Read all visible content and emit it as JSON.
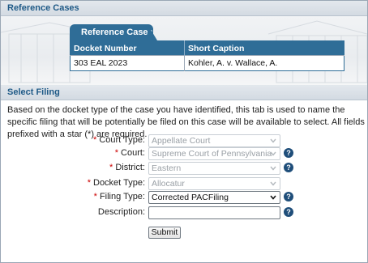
{
  "sections": {
    "reference_cases_title": "Reference Cases",
    "select_filing_title": "Select Filing"
  },
  "reference_tab": {
    "label": "Reference Cases"
  },
  "reference_table": {
    "headers": [
      "Docket Number",
      "Short Caption"
    ],
    "rows": [
      [
        "303 EAL 2023",
        "Kohler, A. v. Wallace, A."
      ]
    ]
  },
  "intro_text": "Based on the docket type of the case you have identified, this tab is used to name the specific filing that will be potentially be filed on this case will be available to select. All fields prefixed with a star (*) are required.",
  "form": {
    "required_marker": "*",
    "court_type": {
      "label": "Court Type:",
      "value": "Appellate Court"
    },
    "court": {
      "label": "Court:",
      "value": "Supreme Court of Pennsylvania"
    },
    "district": {
      "label": "District:",
      "value": "Eastern"
    },
    "docket_type": {
      "label": "Docket Type:",
      "value": "Allocatur"
    },
    "filing_type": {
      "label": "Filing Type:",
      "value": "Corrected PACFiling"
    },
    "description": {
      "label": "Description:",
      "value": ""
    },
    "help_glyph": "?",
    "submit_label": "Submit"
  },
  "colors": {
    "accent": "#2f6d97",
    "header_text": "#1f5a87",
    "required": "#cc0000",
    "help_icon": "#1f4e7a"
  }
}
